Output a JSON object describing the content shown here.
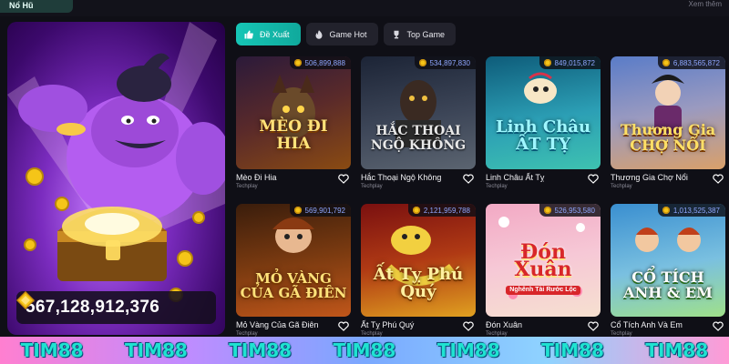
{
  "top": {
    "tab_label": "Nổ Hũ",
    "link_label": "Xem thêm"
  },
  "hero": {
    "jackpot_value": "567,128,912,376"
  },
  "tabs": [
    {
      "label": "Đề Xuất",
      "icon": "thumbs-up-icon",
      "active": true
    },
    {
      "label": "Game Hot",
      "icon": "flame-icon",
      "active": false
    },
    {
      "label": "Top Game",
      "icon": "trophy-icon",
      "active": false
    }
  ],
  "games": [
    {
      "name": "Mèo Đi Hia",
      "provider": "Techplay",
      "jackpot": "506,899,888",
      "art_title": "MÈO ĐI HIA",
      "bg": [
        "#2b1a3a",
        "#8a4b12"
      ]
    },
    {
      "name": "Hắc Thoại Ngộ Không",
      "provider": "Techplay",
      "jackpot": "534,897,830",
      "art_title": "HẮC THOẠI NGỘ KHÔNG",
      "bg": [
        "#1c2436",
        "#5b6470"
      ]
    },
    {
      "name": "Linh Châu Ất Tỵ",
      "provider": "Techplay",
      "jackpot": "849,015,872",
      "art_title": "Linh Châu ẤT TỴ",
      "bg": [
        "#0e5c7a",
        "#3ec2b0"
      ]
    },
    {
      "name": "Thương Gia Chợ Nổi",
      "provider": "Techplay",
      "jackpot": "6,883,565,872",
      "art_title": "Thương Gia CHỢ NỔI",
      "bg": [
        "#5a7cc8",
        "#d9a06a"
      ]
    },
    {
      "name": "Mỏ Vàng Của Gã Điên",
      "provider": "Techplay",
      "jackpot": "569,901,792",
      "art_title": "MỎ VÀNG CỦA GÃ ĐIÊN",
      "bg": [
        "#3a1d0c",
        "#c0561a"
      ]
    },
    {
      "name": "Ất Tỵ Phú Quý",
      "provider": "Techplay",
      "jackpot": "2,121,959,788",
      "art_title": "Ất Tỵ Phú Quý",
      "bg": [
        "#7a1010",
        "#e0a020"
      ]
    },
    {
      "name": "Đón Xuân",
      "provider": "Techplay",
      "jackpot": "526,953,580",
      "art_title": "Đón Xuân",
      "subtitle": "Nghênh Tài Rước Lộc",
      "bg": [
        "#f2a9c4",
        "#f6e0d0"
      ]
    },
    {
      "name": "Cổ Tích Anh Và Em",
      "provider": "Techplay",
      "jackpot": "1,013,525,387",
      "art_title": "CỔ TÍCH ANH & EM",
      "bg": [
        "#3a8fd0",
        "#9fe08a"
      ]
    }
  ],
  "footer": {
    "watermark": "TIM88",
    "repeat": 7
  },
  "colors": {
    "accent": "#16c6b6",
    "badge_text": "#8fa7ff",
    "watermark": "#1fe3d1"
  }
}
